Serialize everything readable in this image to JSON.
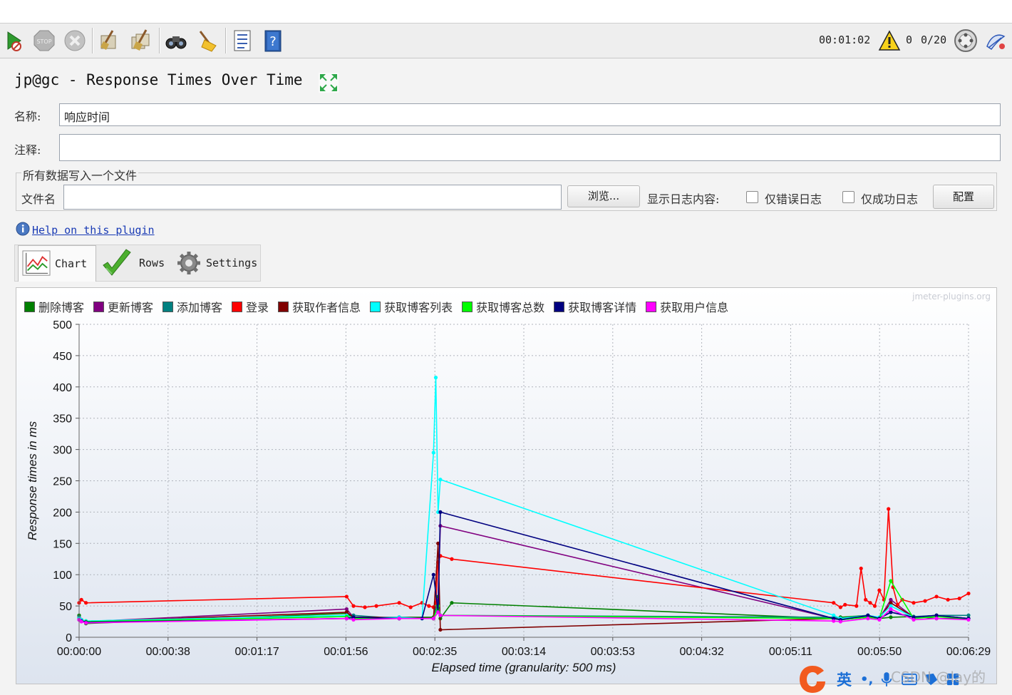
{
  "toolbar": {
    "icons": [
      "start-icon",
      "stop-icon",
      "shutdown-icon",
      "clear-icon",
      "clear-all-icon",
      "search-icon",
      "reset-search-icon",
      "function-helper-icon",
      "help-icon"
    ],
    "elapsed": "00:01:02",
    "warning_count": "0",
    "threads": "0/20"
  },
  "panel": {
    "title": "jp@gc - Response Times Over Time",
    "name_label": "名称:",
    "name_value": "响应时间",
    "comment_label": "注释:",
    "comment_value": "",
    "group_title": "所有数据写入一个文件",
    "filename_label": "文件名",
    "filename_value": "",
    "browse_label": "浏览...",
    "log_content_label": "显示日志内容:",
    "errors_only_label": "仅错误日志",
    "success_only_label": "仅成功日志",
    "configure_label": "配置",
    "help_link": "Help on this plugin"
  },
  "tabs": [
    {
      "label": "Chart",
      "icon": "chart-icon",
      "active": true
    },
    {
      "label": "Rows",
      "icon": "checkmark-icon",
      "active": false
    },
    {
      "label": "Settings",
      "icon": "gear-icon",
      "active": false
    }
  ],
  "chart_data": {
    "type": "line",
    "watermark": "jmeter-plugins.org",
    "xlabel": "Elapsed time (granularity: 500 ms)",
    "ylabel": "Response times in ms",
    "x_unit": "seconds elapsed",
    "xlim": [
      0,
      389
    ],
    "ylim": [
      0,
      500
    ],
    "yticks": [
      0,
      50,
      100,
      150,
      200,
      250,
      300,
      350,
      400,
      450,
      500
    ],
    "xtick_labels": [
      "00:00:00",
      "00:00:38",
      "00:01:17",
      "00:01:56",
      "00:02:35",
      "00:03:14",
      "00:03:53",
      "00:04:32",
      "00:05:11",
      "00:05:50",
      "00:06:29"
    ],
    "grid": true,
    "legend_position": "top-left",
    "series": [
      {
        "name": "删除博客",
        "color": "#008000",
        "x": [
          0,
          1,
          3,
          117,
          120,
          140,
          155,
          157,
          158,
          163,
          330,
          333,
          345,
          350,
          355,
          365,
          375,
          389
        ],
        "y": [
          35,
          28,
          22,
          38,
          30,
          32,
          32,
          65,
          30,
          55,
          30,
          32,
          35,
          30,
          32,
          33,
          30,
          30
        ]
      },
      {
        "name": "更新博客",
        "color": "#800080",
        "x": [
          0,
          1,
          3,
          117,
          120,
          140,
          155,
          157,
          158,
          330,
          333,
          345,
          350,
          355,
          365,
          375,
          389
        ],
        "y": [
          30,
          28,
          25,
          45,
          32,
          30,
          30,
          60,
          178,
          30,
          28,
          35,
          30,
          60,
          32,
          35,
          30
        ]
      },
      {
        "name": "添加博客",
        "color": "#008080",
        "x": [
          0,
          1,
          3,
          117,
          120,
          140,
          155,
          157,
          158,
          330,
          333,
          345,
          350,
          355,
          365,
          375,
          389
        ],
        "y": [
          32,
          27,
          26,
          33,
          35,
          30,
          30,
          55,
          35,
          32,
          30,
          33,
          30,
          40,
          33,
          35,
          35
        ]
      },
      {
        "name": "登录",
        "color": "#ff0000",
        "x": [
          0,
          1,
          3,
          117,
          120,
          125,
          130,
          140,
          145,
          150,
          153,
          155,
          156,
          157,
          158,
          163,
          330,
          333,
          335,
          340,
          342,
          344,
          346,
          348,
          350,
          352,
          354,
          356,
          358,
          360,
          365,
          370,
          375,
          380,
          385,
          389
        ],
        "y": [
          55,
          60,
          55,
          65,
          50,
          48,
          50,
          55,
          48,
          55,
          50,
          48,
          55,
          120,
          130,
          125,
          55,
          48,
          52,
          50,
          110,
          60,
          55,
          50,
          75,
          60,
          205,
          80,
          52,
          60,
          55,
          58,
          65,
          60,
          62,
          70
        ]
      },
      {
        "name": "获取作者信息",
        "color": "#800000",
        "x": [
          0,
          1,
          3,
          117,
          120,
          140,
          155,
          157,
          158,
          330,
          333,
          345,
          350,
          355,
          365,
          375,
          389
        ],
        "y": [
          30,
          28,
          25,
          40,
          32,
          32,
          30,
          150,
          12,
          30,
          28,
          32,
          30,
          55,
          32,
          35,
          30
        ]
      },
      {
        "name": "获取博客列表",
        "color": "#00ffff",
        "x": [
          0,
          1,
          3,
          117,
          120,
          140,
          150,
          155,
          156,
          157,
          158,
          330,
          333,
          345,
          350,
          355,
          365,
          375,
          389
        ],
        "y": [
          30,
          28,
          26,
          35,
          30,
          32,
          30,
          295,
          415,
          200,
          252,
          35,
          30,
          35,
          32,
          50,
          32,
          35,
          30
        ]
      },
      {
        "name": "获取博客总数",
        "color": "#00ff00",
        "x": [
          0,
          1,
          3,
          117,
          120,
          140,
          155,
          157,
          158,
          330,
          333,
          345,
          350,
          355,
          365,
          375,
          389
        ],
        "y": [
          28,
          26,
          25,
          33,
          30,
          30,
          30,
          50,
          35,
          30,
          28,
          32,
          30,
          90,
          30,
          33,
          30
        ]
      },
      {
        "name": "获取博客详情",
        "color": "#000080",
        "x": [
          0,
          1,
          3,
          117,
          120,
          140,
          150,
          155,
          157,
          158,
          330,
          333,
          345,
          350,
          355,
          365,
          375,
          389
        ],
        "y": [
          28,
          26,
          24,
          30,
          32,
          30,
          30,
          100,
          40,
          200,
          30,
          28,
          35,
          30,
          40,
          32,
          35,
          30
        ]
      },
      {
        "name": "获取用户信息",
        "color": "#ff00ff",
        "x": [
          0,
          1,
          3,
          117,
          120,
          140,
          155,
          157,
          158,
          330,
          333,
          345,
          350,
          355,
          365,
          375,
          389
        ],
        "y": [
          28,
          25,
          23,
          30,
          28,
          30,
          30,
          40,
          35,
          26,
          25,
          30,
          28,
          45,
          28,
          30,
          28
        ]
      }
    ]
  },
  "ime": {
    "lang": "英",
    "punct": "•,",
    "watermark": "CSDN @lay的"
  }
}
